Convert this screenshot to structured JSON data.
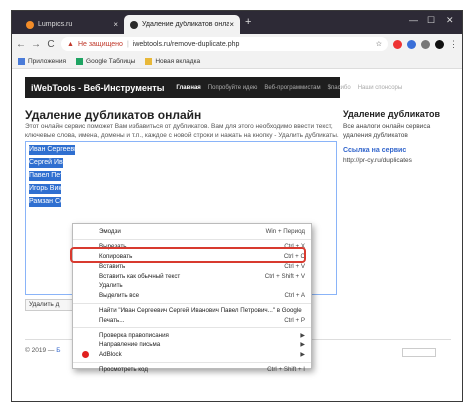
{
  "browser": {
    "tabs": [
      {
        "title": "Lumpics.ru",
        "active": false
      },
      {
        "title": "Удаление дубликатов онлайн",
        "active": true
      }
    ],
    "close_glyph": "×",
    "new_tab_glyph": "+",
    "window_controls": {
      "minimize": "—",
      "maximize": "☐",
      "close": "✕"
    },
    "nav": {
      "back": "←",
      "forward": "→",
      "reload": "C"
    },
    "address": {
      "security_label": "Не защищено",
      "separator": "|",
      "url": "iwebtools.ru/remove-duplicate.php"
    },
    "star_glyph": "☆",
    "bookmarks": [
      {
        "label": "Приложения",
        "icon": "apps-grid-icon",
        "color": "#4a7bd8"
      },
      {
        "label": "Google Таблицы",
        "icon": "sheets-icon",
        "color": "#1fa463"
      },
      {
        "label": "Новая вкладка",
        "icon": "folder-icon",
        "color": "#e8b839"
      }
    ]
  },
  "site": {
    "logo": "iWebTools - Веб-Инструменты",
    "nav": [
      {
        "label": "Главная",
        "active": true
      },
      {
        "label": "Попробуйте идею",
        "active": false
      },
      {
        "label": "Веб-программистам",
        "active": false
      },
      {
        "label": "$пасибо",
        "active": false
      },
      {
        "label": "Наши спонсоры",
        "active": false
      }
    ],
    "title": "Удаление дубликатов онлайн",
    "description": "Этот онлайн сервис поможет Вам избавиться от дубликатов. Вам для этого необходимо ввести текст, ключевые слова, имена, домены и т.п., каждое с новой строки и нажать на кнопку - Удалить дубликаты.",
    "textarea_lines": [
      "Иван Сергееви",
      "Сергей Иван",
      "Павел Петр",
      "Игорь Викт",
      "Рамзан Се"
    ],
    "remove_button": "Удалить д",
    "footer_prefix": "© 2019 —",
    "footer_link": "Б",
    "sidebar": {
      "heading": "Удаление дубликатов",
      "desc": "Все аналоги онлайн сервиса удаления дубликатов",
      "link": "Ссылка на сервис",
      "url": "http://pr-cy.ru/duplicates"
    }
  },
  "context_menu": {
    "items": [
      {
        "label": "Эмодзи",
        "shortcut": "Win + Период"
      },
      {
        "sep": true
      },
      {
        "label": "Вырезать",
        "shortcut": "Ctrl + X"
      },
      {
        "label": "Копировать",
        "shortcut": "Ctrl + C",
        "highlight": true
      },
      {
        "label": "Вставить",
        "shortcut": "Ctrl + V"
      },
      {
        "label": "Вставить как обычный текст",
        "shortcut": "Ctrl + Shift + V"
      },
      {
        "label": "Удалить",
        "shortcut": ""
      },
      {
        "label": "Выделить все",
        "shortcut": "Ctrl + A"
      },
      {
        "sep": true
      },
      {
        "label": "Найти \"Иван Сергеевич Сергей Иванович Павел Петрович...\" в Google",
        "shortcut": ""
      },
      {
        "label": "Печать...",
        "shortcut": "Ctrl + P"
      },
      {
        "sep": true
      },
      {
        "label": "Проверка правописания",
        "shortcut": "",
        "submenu": true
      },
      {
        "label": "Направление письма",
        "shortcut": "",
        "submenu": true
      },
      {
        "label": "AdBlock",
        "shortcut": "",
        "submenu": true,
        "adblock": true
      },
      {
        "sep": true
      },
      {
        "label": "Просмотреть код",
        "shortcut": "Ctrl + Shift + I"
      }
    ]
  }
}
